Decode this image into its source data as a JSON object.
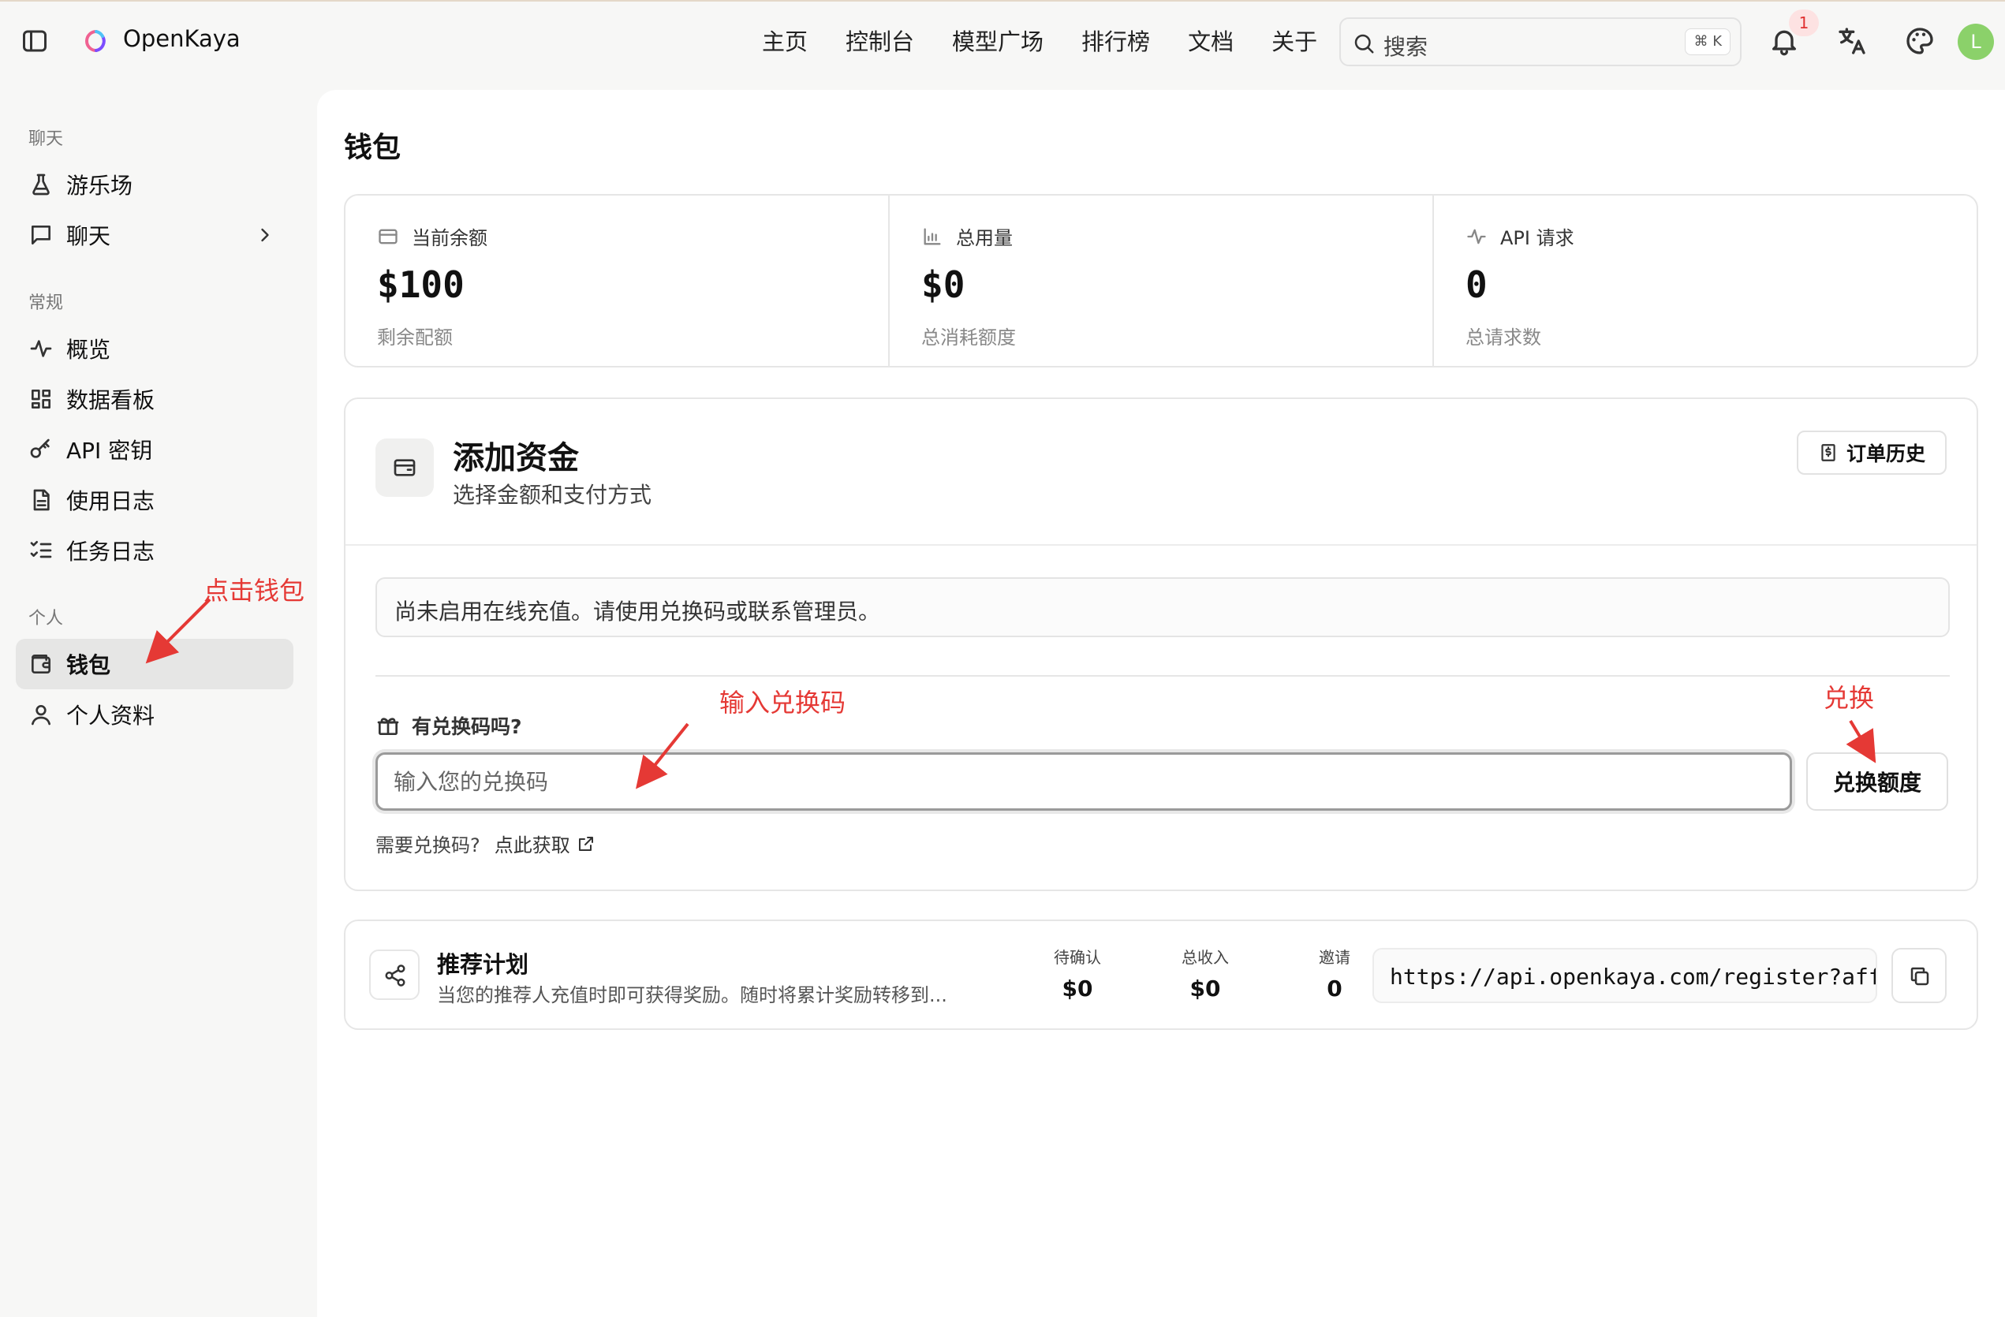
{
  "app": {
    "brand": "OpenKaya"
  },
  "nav": {
    "items": [
      "主页",
      "控制台",
      "模型广场",
      "排行榜",
      "文档",
      "关于"
    ]
  },
  "search": {
    "placeholder": "搜索",
    "shortcut": "⌘ K"
  },
  "header": {
    "notification_count": "1",
    "avatar_letter": "L",
    "avatar_color": "#8bd16a"
  },
  "sidebar": {
    "sections": {
      "chat": "聊天",
      "general": "常规",
      "personal": "个人"
    },
    "items": {
      "playground": "游乐场",
      "chat": "聊天",
      "overview": "概览",
      "dashboard": "数据看板",
      "api_keys": "API 密钥",
      "usage_logs": "使用日志",
      "task_logs": "任务日志",
      "wallet": "钱包",
      "profile": "个人资料"
    }
  },
  "main": {
    "title": "钱包",
    "stats": [
      {
        "label": "当前余额",
        "value": "$100",
        "sub": "剩余配额",
        "icon": "wallet-icon"
      },
      {
        "label": "总用量",
        "value": "$0",
        "sub": "总消耗额度",
        "icon": "bar-chart-icon"
      },
      {
        "label": "API 请求",
        "value": "0",
        "sub": "总请求数",
        "icon": "activity-icon"
      }
    ],
    "funds": {
      "title": "添加资金",
      "subtitle": "选择金额和支付方式",
      "order_history": "订单历史",
      "notice": "尚未启用在线充值。请使用兑换码或联系管理员。",
      "redeem_label": "有兑换码吗?",
      "redeem_placeholder": "输入您的兑换码",
      "redeem_button": "兑换额度",
      "help_text": "需要兑换码?",
      "help_link": "点此获取"
    },
    "referral": {
      "title": "推荐计划",
      "description": "当您的推荐人充值时即可获得奖励。随时将累计奖励转移到...",
      "stats": [
        {
          "label": "待确认",
          "value": "$0"
        },
        {
          "label": "总收入",
          "value": "$0"
        },
        {
          "label": "邀请",
          "value": "0"
        }
      ],
      "link": "https://api.openkaya.com/register?aff=..."
    }
  },
  "annotations": {
    "click_wallet": "点击钱包",
    "enter_code": "输入兑换码",
    "redeem": "兑换",
    "color": "#e53935"
  }
}
